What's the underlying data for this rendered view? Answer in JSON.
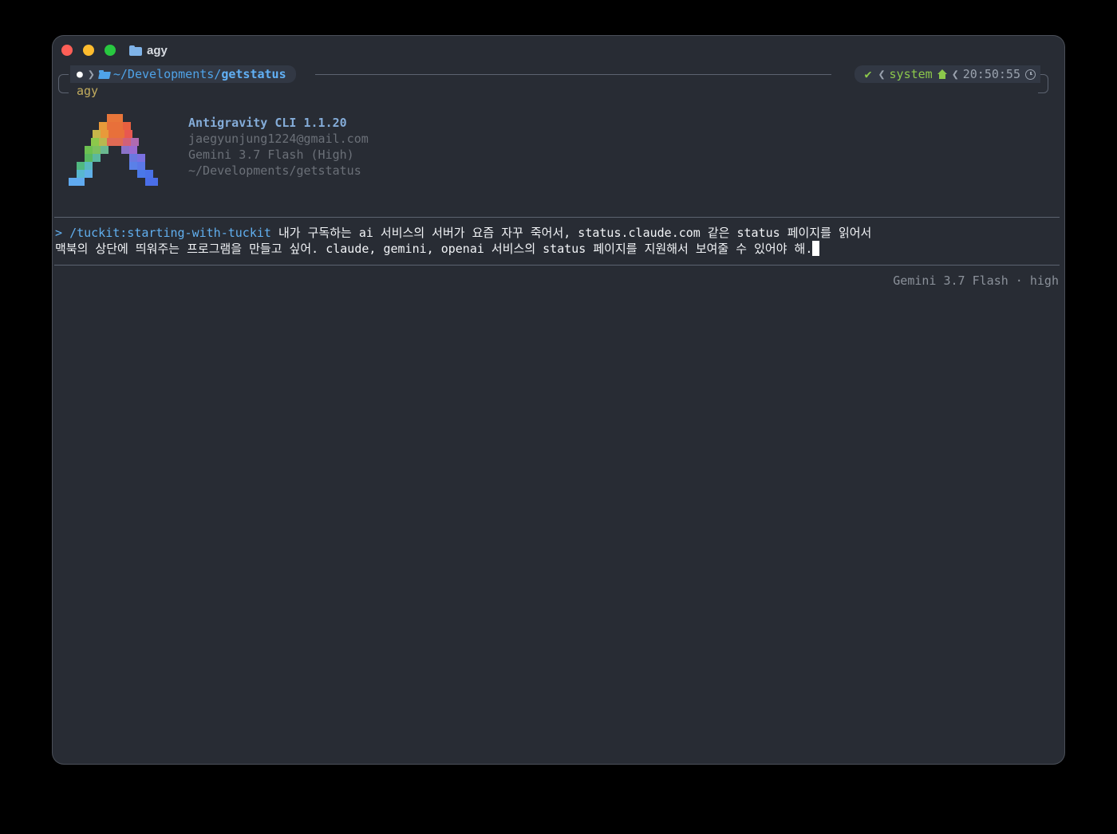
{
  "window": {
    "title": "agy"
  },
  "prompt": {
    "path_prefix": "~/Developments/",
    "path_current": "getstatus",
    "check": "✔",
    "env": "system",
    "time": "20:50:55",
    "command_echo": "agy"
  },
  "banner": {
    "app_name": "Antigravity CLI 1.1.20",
    "email": "jaegyunjung1224@gmail.com",
    "model": "Gemini 3.7 Flash (High)",
    "cwd": "~/Developments/getstatus"
  },
  "input": {
    "prompt_marker": ">",
    "slash_command": "/tuckit:starting-with-tuckit",
    "line1": "내가 구독하는 ai 서비스의 서버가 요즘 자꾸 죽어서, status.claude.com 같은 status 페이지를 읽어서",
    "line2": "맥북의 상단에 띄워주는 프로그램을 만들고 싶어. claude, gemini, openai 서비스의 status 페이지를 지원해서 보여줄 수 있어야 해."
  },
  "footer": {
    "model_status": "Gemini 3.7 Flash · high"
  },
  "colors": {
    "background": "#000000",
    "terminal_bg": "#282c34",
    "accent_blue": "#61afef",
    "accent_green": "#8cc84b",
    "accent_yellow": "#c2ac5e"
  }
}
